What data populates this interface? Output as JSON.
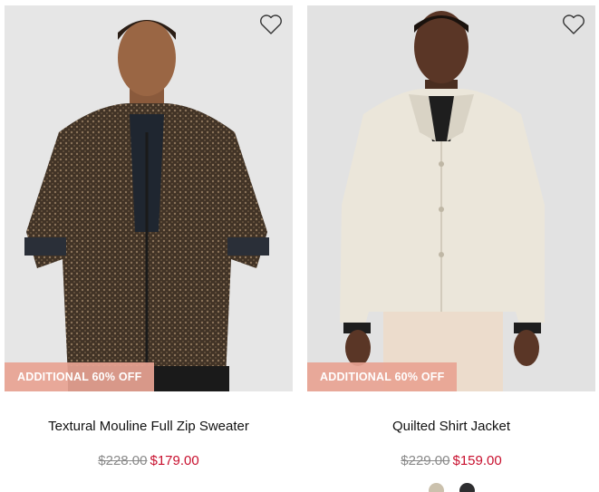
{
  "products": [
    {
      "name": "Textural Mouline Full Zip Sweater",
      "promo": "ADDITIONAL 60% OFF",
      "price_was": "$228.00",
      "price_now": "$179.00",
      "wishlist_icon": "heart-outline-icon"
    },
    {
      "name": "Quilted Shirt Jacket",
      "promo": "ADDITIONAL 60% OFF",
      "price_was": "$229.00",
      "price_now": "$159.00",
      "wishlist_icon": "heart-outline-icon",
      "swatches": [
        {
          "color": "#cbc1ad"
        },
        {
          "color": "#2e2e30"
        }
      ]
    }
  ],
  "colors": {
    "promo_bg": "#e8a392",
    "sale_price": "#c8102e",
    "was_price": "#8a8a8a"
  }
}
